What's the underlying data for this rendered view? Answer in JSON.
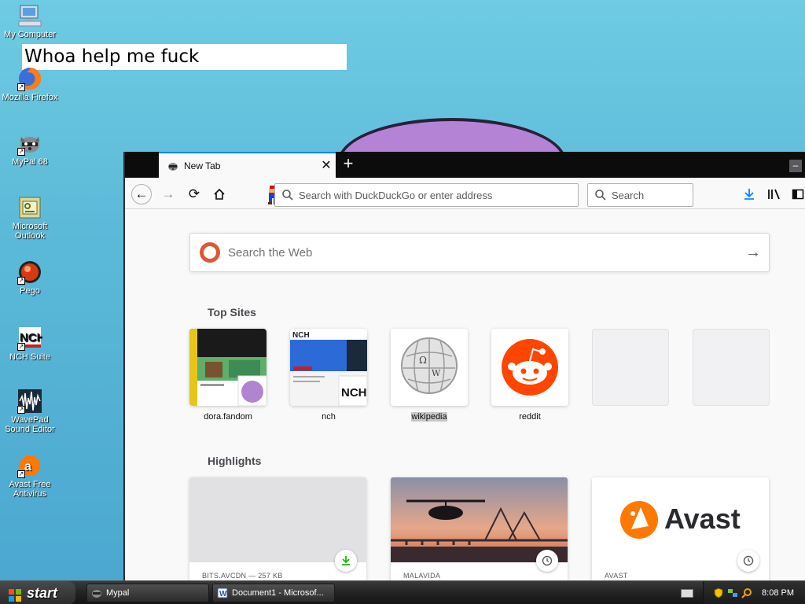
{
  "desktop": {
    "icons": [
      {
        "label": "My Computer"
      },
      {
        "label": "Mozilla Firefox"
      },
      {
        "label": "MyPal 68"
      },
      {
        "label": "Microsoft Outlook"
      },
      {
        "label": "Pego"
      },
      {
        "label": "NCH Suite"
      },
      {
        "label": "WavePad Sound Editor"
      },
      {
        "label": "Avast Free Antivirus"
      }
    ],
    "textbox": "Whoa help me fuck"
  },
  "browser": {
    "tab": {
      "title": "New Tab",
      "close": "✕"
    },
    "newtab_symbol": "+",
    "url_placeholder": "Search with DuckDuckGo or enter address",
    "search_placeholder": "Search",
    "page": {
      "search_placeholder": "Search the Web",
      "top_sites_title": "Top Sites",
      "top_sites": [
        {
          "label": "dora.fandom"
        },
        {
          "label": "nch"
        },
        {
          "label": "wikipedia"
        },
        {
          "label": "reddit"
        },
        {
          "label": ""
        },
        {
          "label": ""
        }
      ],
      "highlights_title": "Highlights",
      "highlights": [
        {
          "meta": "BITS.AVCDN — 257 KB",
          "badge": "download"
        },
        {
          "meta": "MALAVIDA",
          "badge": "clock"
        },
        {
          "meta": "AVAST",
          "badge": "clock",
          "logo_text": "Avast"
        }
      ]
    }
  },
  "taskbar": {
    "start_label": "start",
    "tasks": [
      {
        "label": "Mypal"
      },
      {
        "label": "Document1 - Microsof..."
      }
    ],
    "clock": "8:08 PM"
  },
  "colors": {
    "accent": "#0a84ff",
    "reddit": "#ff4500",
    "avast": "#ff7800",
    "ddg": "#de5833"
  }
}
